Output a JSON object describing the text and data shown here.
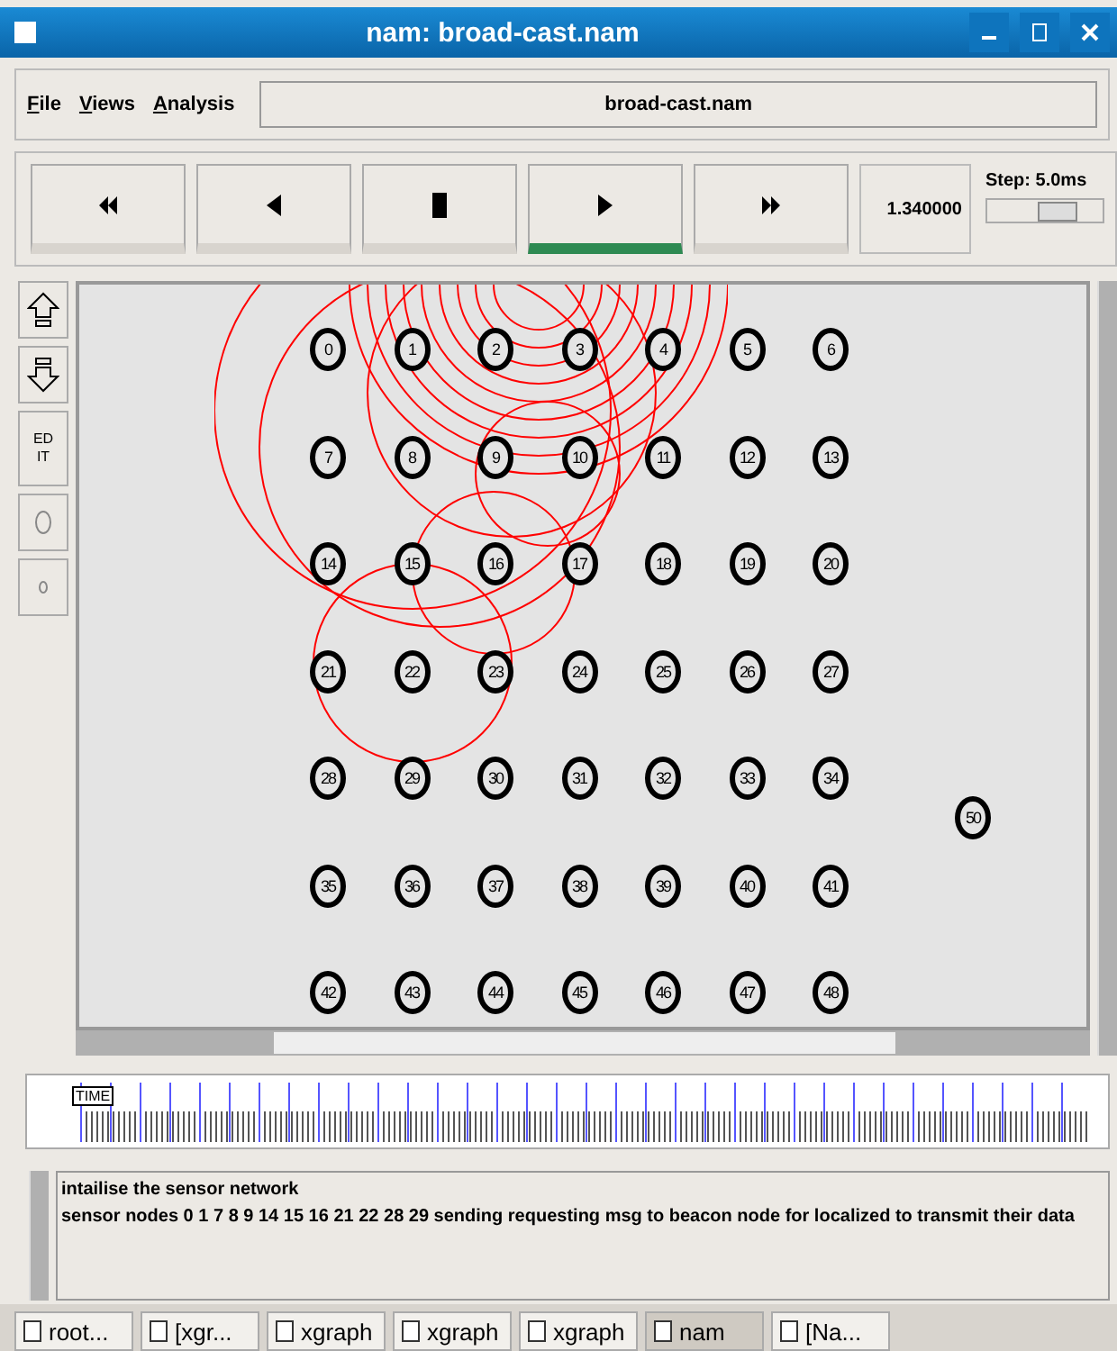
{
  "window": {
    "title": "nam: broad-cast.nam"
  },
  "menu": [
    {
      "label": "File"
    },
    {
      "label": "Views"
    },
    {
      "label": "Analysis"
    }
  ],
  "file_field": "broad-cast.nam",
  "transport": [
    {
      "kind": "rewind",
      "selected": false
    },
    {
      "kind": "back",
      "selected": false
    },
    {
      "kind": "stop",
      "selected": false
    },
    {
      "kind": "play",
      "selected": true
    },
    {
      "kind": "forward",
      "selected": false
    }
  ],
  "time": "1.340000",
  "step": {
    "label": "Step: 5.0ms",
    "level": 0.6
  },
  "side_tools": [
    {
      "kind": "zoom-in"
    },
    {
      "kind": "zoom-out"
    },
    {
      "kind": "text",
      "label": "ED IT"
    },
    {
      "kind": "big-node"
    },
    {
      "kind": "small-node"
    }
  ],
  "node_rows": [
    [
      "0",
      "1",
      "2",
      "3",
      "4",
      "5",
      "6"
    ],
    [
      "7",
      "8",
      "9",
      "10",
      "11",
      "12",
      "13"
    ],
    [
      "14",
      "15",
      "16",
      "17",
      "18",
      "19",
      "20"
    ],
    [
      "21",
      "22",
      "23",
      "24",
      "25",
      "26",
      "27"
    ],
    [
      "28",
      "29",
      "30",
      "31",
      "32",
      "33",
      "34"
    ],
    [
      "35",
      "36",
      "37",
      "38",
      "39",
      "40",
      "41"
    ],
    [
      "42",
      "43",
      "44",
      "45",
      "46",
      "47",
      "48"
    ]
  ],
  "beacon_node": "50",
  "timeline_marker": "TIME",
  "log": [
    "intailise the sensor network",
    "sensor nodes 0 1 7 8 9 14 15 16 21 22 28 29 sending requesting msg to beacon node for localized to transmit their data"
  ],
  "taskbar": [
    {
      "label": "root...",
      "selected": false
    },
    {
      "label": "[xgr...",
      "selected": false
    },
    {
      "label": "xgraph",
      "selected": false
    },
    {
      "label": "xgraph",
      "selected": false
    },
    {
      "label": "xgraph",
      "selected": false
    },
    {
      "label": "nam",
      "selected": true
    },
    {
      "label": "[Na...",
      "selected": false
    }
  ]
}
